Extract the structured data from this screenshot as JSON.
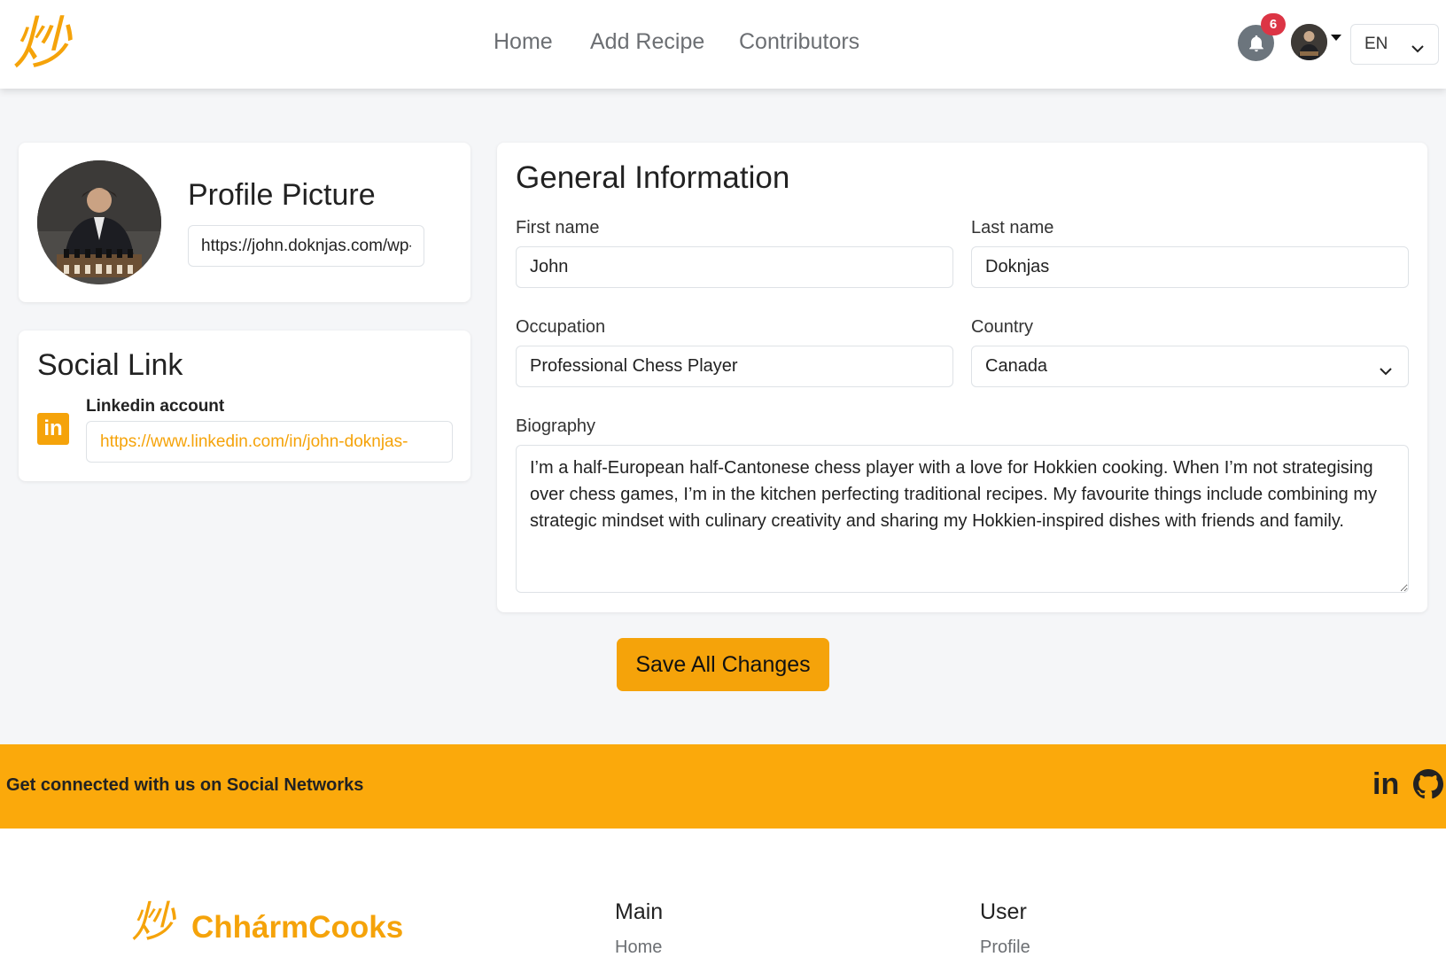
{
  "brand": {
    "logo_glyph": "炒",
    "name": "ChhármCooks",
    "accent_color": "#f5a30a"
  },
  "nav": {
    "links": [
      "Home",
      "Add Recipe",
      "Contributors"
    ],
    "notification_count": "6",
    "language": "EN"
  },
  "profile": {
    "title": "Profile Picture",
    "picture_url": "https://john.doknjas.com/wp-content/uploads/profile.jpg"
  },
  "social": {
    "title": "Social Link",
    "linkedin_label": "Linkedin account",
    "linkedin_url": "https://www.linkedin.com/in/john-doknjas-"
  },
  "general": {
    "title": "General Information",
    "first_name_label": "First name",
    "first_name": "John",
    "last_name_label": "Last name",
    "last_name": "Doknjas",
    "occupation_label": "Occupation",
    "occupation": "Professional Chess Player",
    "country_label": "Country",
    "country": "Canada",
    "biography_label": "Biography",
    "biography": "I’m a half-European half-Cantonese chess player with a love for Hokkien cooking. When I’m not strategising over chess games, I’m in the kitchen perfecting traditional recipes. My favourite things include combining my strategic mindset with culinary creativity and sharing my Hokkien-inspired dishes with friends and family."
  },
  "actions": {
    "save_label": "Save All Changes"
  },
  "banner": {
    "text": "Get connected with us on Social Networks",
    "linkedin_glyph": "in"
  },
  "footer": {
    "main_heading": "Main",
    "main_link": "Home",
    "user_heading": "User",
    "user_link": "Profile"
  }
}
